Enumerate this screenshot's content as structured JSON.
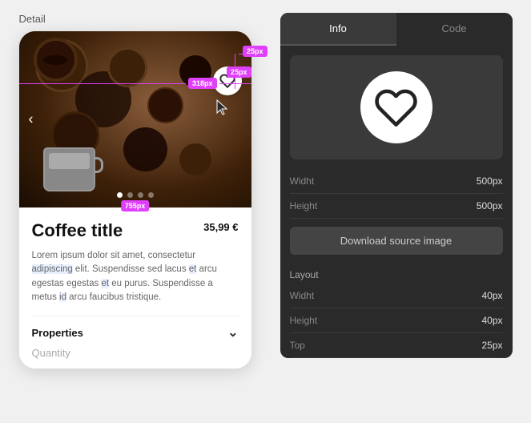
{
  "panel": {
    "label": "Detail"
  },
  "tabs": {
    "info": "Info",
    "code": "Code",
    "active": "info"
  },
  "card": {
    "title": "Coffee title",
    "price": "35,99 €",
    "description": "Lorem ipsum dolor sit amet, consectetur adipiscing elit. Suspendisse sed lacus et arcu egestas egestas et eu purus. Suspendisse a metus id arcu faucibus tristique.",
    "properties_label": "Properties",
    "quantity_label": "Quantity"
  },
  "measurements": {
    "top_25": "25px",
    "width_318": "318px",
    "right_25": "25px",
    "bottom_755": "755px"
  },
  "info": {
    "width_label": "Widht",
    "width_val": "500px",
    "height_label": "Height",
    "height_val": "500px",
    "download_btn": "Download source image",
    "layout_label": "Layout",
    "layout_width_label": "Widht",
    "layout_width_val": "40px",
    "layout_height_label": "Height",
    "layout_height_val": "40px",
    "layout_top_label": "Top",
    "layout_top_val": "25px"
  }
}
